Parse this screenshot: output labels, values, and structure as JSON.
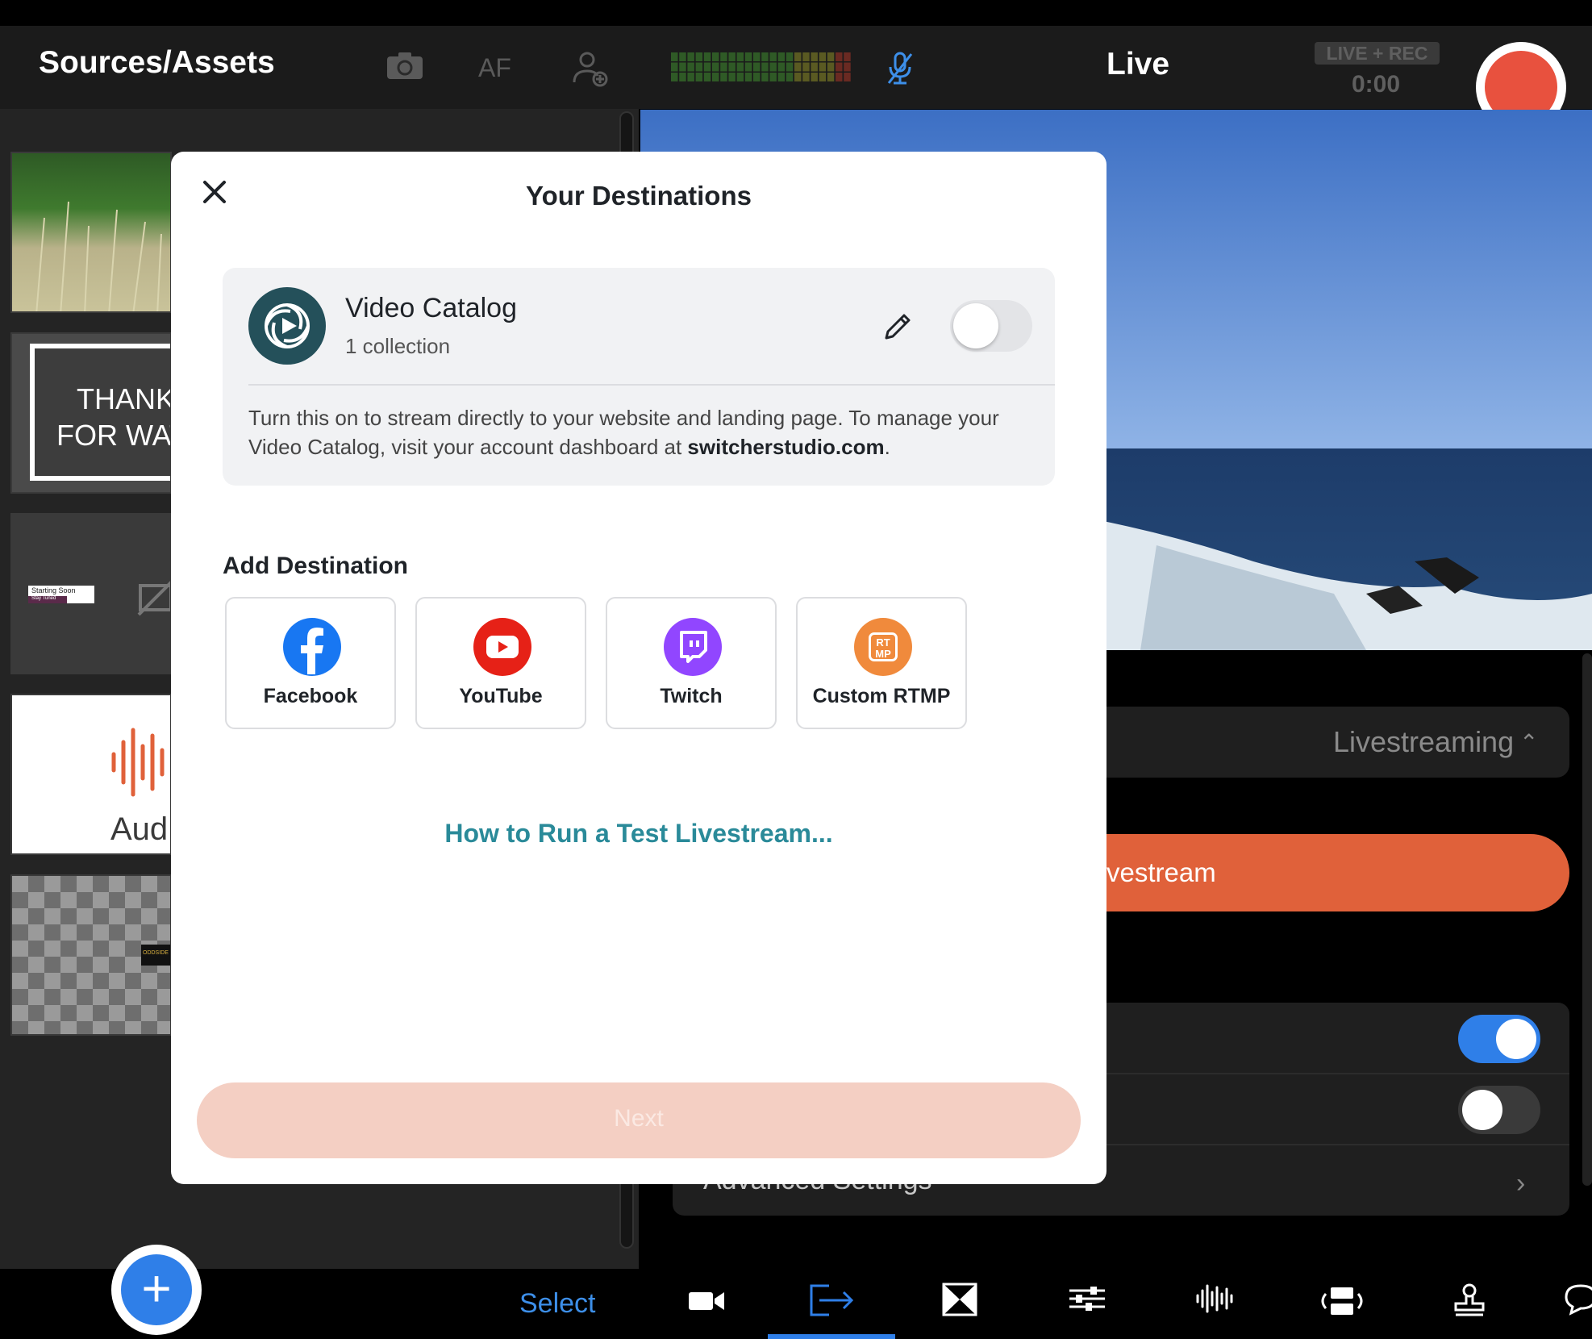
{
  "app": {
    "left_panel_title": "Sources/Assets",
    "af_label": "AF",
    "live_title": "Live",
    "live_rec_badge": "LIVE + REC",
    "timer": "0:00",
    "select_label": "Select"
  },
  "thumbnails": [
    {
      "name": "wheat-field"
    },
    {
      "text_line1": "THANK",
      "text_line2": "FOR WAT"
    },
    {
      "small_title": "Starting Soon",
      "small_sub": "Stay Tuned"
    },
    {
      "text": "Aud"
    },
    {
      "badge": "ODDSIDE"
    }
  ],
  "behind_modal": {
    "livestream_select_label": "Livestreaming",
    "livestream_button_label": "vestream",
    "advanced_settings_label": "Advanced Settings",
    "toggle1_on": true,
    "toggle2_on": false
  },
  "modal": {
    "title": "Your Destinations",
    "video_catalog": {
      "title": "Video Catalog",
      "subtitle": "1 collection",
      "enabled": false,
      "description_prefix": "Turn this on to stream directly to your website and landing page. To manage your Video Catalog, visit your account dashboard at ",
      "description_link": "switcherstudio.com",
      "description_suffix": "."
    },
    "add_destination_title": "Add Destination",
    "destinations": [
      {
        "label": "Facebook",
        "icon": "facebook-icon",
        "color": "#1877f2"
      },
      {
        "label": "YouTube",
        "icon": "youtube-icon",
        "color": "#e62117"
      },
      {
        "label": "Twitch",
        "icon": "twitch-icon",
        "color": "#9146ff"
      },
      {
        "label": "Custom RTMP",
        "icon": "rtmp-icon",
        "color": "#f08a3c",
        "icon_text": "RT\nMP"
      }
    ],
    "help_link": "How to Run a Test Livestream...",
    "next_label": "Next"
  },
  "colors": {
    "accent_blue": "#2f7fe8",
    "record_red": "#e8513e",
    "livestream_orange": "#e0613a",
    "link_teal": "#2a8a99"
  },
  "bottom_tabs": [
    "camera-icon",
    "output-icon",
    "transition-icon",
    "sliders-icon",
    "audio-waveform-icon",
    "rotate-camera-icon",
    "stamp-icon",
    "comment-icon"
  ]
}
